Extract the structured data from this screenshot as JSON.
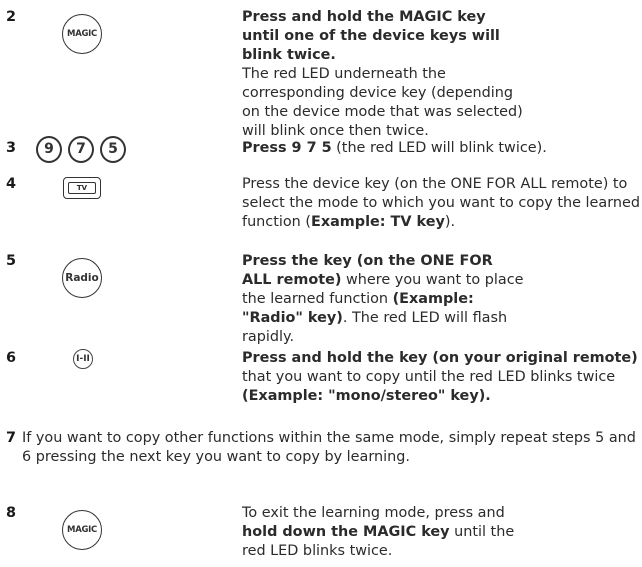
{
  "steps": [
    {
      "number": "2",
      "icon": "magic-key-icon",
      "icon_label": "MAGIC",
      "bold": "Press and hold the MAGIC key until one of the device keys will blink twice.",
      "text": "The red LED underneath the corresponding device key (depending on the device mode that was selected) will blink once then twice."
    },
    {
      "number": "3",
      "icon": "digit-keys-icon",
      "digits": [
        "9",
        "7",
        "5"
      ],
      "bold": "Press 9 7 5",
      "text": " (the red LED will blink twice)."
    },
    {
      "number": "4",
      "icon": "tv-key-icon",
      "icon_label": "TV",
      "text": "Press the device key (on the ONE FOR ALL remote) to select the mode to which you want to copy the learned function (",
      "bold": "Example: TV key",
      "text_end": ")."
    },
    {
      "number": "5",
      "icon": "radio-key-icon",
      "icon_label": "Radio",
      "bold": "Press the key (on the ONE FOR ALL remote)",
      "text": " where you want to place the learned function ",
      "bold2": "(Example: \"Radio\" key)",
      "text_end": ". The red LED will flash rapidly."
    },
    {
      "number": "6",
      "icon": "mono-stereo-key-icon",
      "icon_label": "I-II",
      "bold": "Press and hold the key (on your original remote)",
      "text": " that you want to copy until the red LED blinks twice ",
      "bold2": "(Example: \"mono/stereo\" key)."
    },
    {
      "number": "7",
      "text": "If you want to copy other functions within the same mode, simply repeat steps 5 and 6 pressing the next key you want to copy by learning."
    },
    {
      "number": "8",
      "icon": "magic-key-icon",
      "icon_label": "MAGIC",
      "text": "To exit the learning mode, press and ",
      "bold": "hold down the MAGIC key",
      "text_end": " until the red LED blinks twice."
    }
  ]
}
